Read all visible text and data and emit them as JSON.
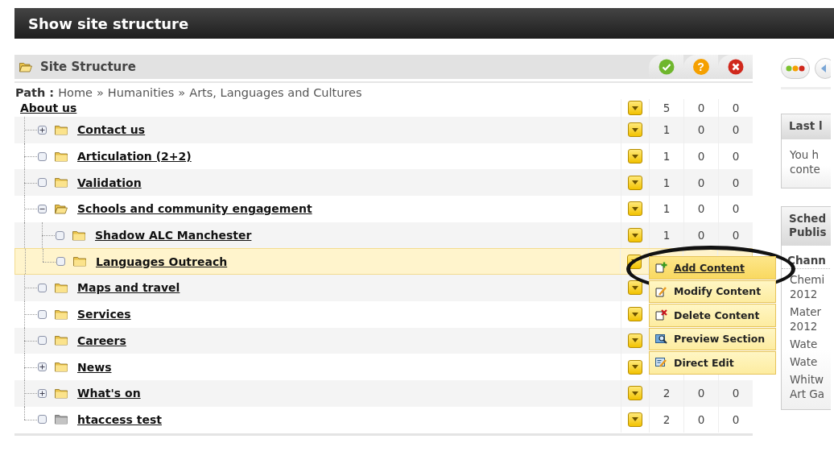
{
  "window": {
    "title": "Show site structure"
  },
  "panel": {
    "title": "Site Structure",
    "actions": [
      {
        "kind": "accept"
      },
      {
        "kind": "help",
        "glyph": "?"
      },
      {
        "kind": "close"
      }
    ]
  },
  "path": {
    "label": "Path :",
    "separator": "»",
    "crumbs": [
      "Home",
      "Humanities",
      "Arts, Languages and Cultures"
    ]
  },
  "tree": {
    "label": "About us",
    "counts": [
      "5",
      "0",
      "0"
    ],
    "children": [
      {
        "label": "Contact us",
        "kind": "collapsed",
        "selected": false,
        "inactive": false,
        "counts": [
          "1",
          "0",
          "0"
        ]
      },
      {
        "label": "Articulation (2+2)",
        "kind": "leaf",
        "selected": false,
        "inactive": false,
        "counts": [
          "1",
          "0",
          "0"
        ]
      },
      {
        "label": "Validation",
        "kind": "leaf",
        "selected": false,
        "inactive": false,
        "counts": [
          "1",
          "0",
          "0"
        ]
      },
      {
        "label": "Schools and community engagement",
        "kind": "expanded",
        "selected": false,
        "inactive": false,
        "counts": [
          "1",
          "0",
          "0"
        ],
        "children": [
          {
            "label": "Shadow ALC Manchester",
            "kind": "leaf",
            "selected": false,
            "inactive": false,
            "counts": [
              "1",
              "0",
              "0"
            ]
          },
          {
            "label": "Languages Outreach",
            "kind": "leaf",
            "selected": true,
            "inactive": false
          }
        ]
      },
      {
        "label": "Maps and travel",
        "kind": "leaf",
        "selected": false,
        "inactive": false
      },
      {
        "label": "Services",
        "kind": "leaf",
        "selected": false,
        "inactive": false
      },
      {
        "label": "Careers",
        "kind": "leaf",
        "selected": false,
        "inactive": false
      },
      {
        "label": "News",
        "kind": "collapsed",
        "selected": false,
        "inactive": false
      },
      {
        "label": "What's on",
        "kind": "collapsed",
        "selected": false,
        "inactive": false,
        "counts": [
          "2",
          "0",
          "0"
        ]
      },
      {
        "label": "htaccess test",
        "kind": "leaf",
        "selected": false,
        "inactive": true,
        "counts": [
          "2",
          "0",
          "0"
        ]
      }
    ]
  },
  "context_menu": {
    "items": [
      {
        "label": "Add Content",
        "kind": "add",
        "selected": true
      },
      {
        "label": "Modify Content",
        "kind": "modify",
        "selected": false
      },
      {
        "label": "Delete Content",
        "kind": "delete",
        "selected": false
      },
      {
        "label": "Preview Section",
        "kind": "preview",
        "selected": false
      },
      {
        "label": "Direct Edit",
        "kind": "edit",
        "selected": false
      }
    ]
  },
  "sidebar": {
    "buttons": [
      {
        "kind": "status"
      },
      {
        "kind": "link"
      }
    ],
    "boxes": [
      {
        "heading": [
          "Last l"
        ],
        "lines": [
          "You h",
          "conte"
        ]
      },
      {
        "heading": [
          "Sched",
          "Publis"
        ],
        "subheading": "Chann",
        "items": [
          [
            "Chemi",
            "2012"
          ],
          [
            "Mater",
            "2012"
          ],
          [
            "Wate"
          ],
          [
            "Wate"
          ],
          [
            "Whitw",
            "Art Ga"
          ]
        ]
      }
    ]
  }
}
